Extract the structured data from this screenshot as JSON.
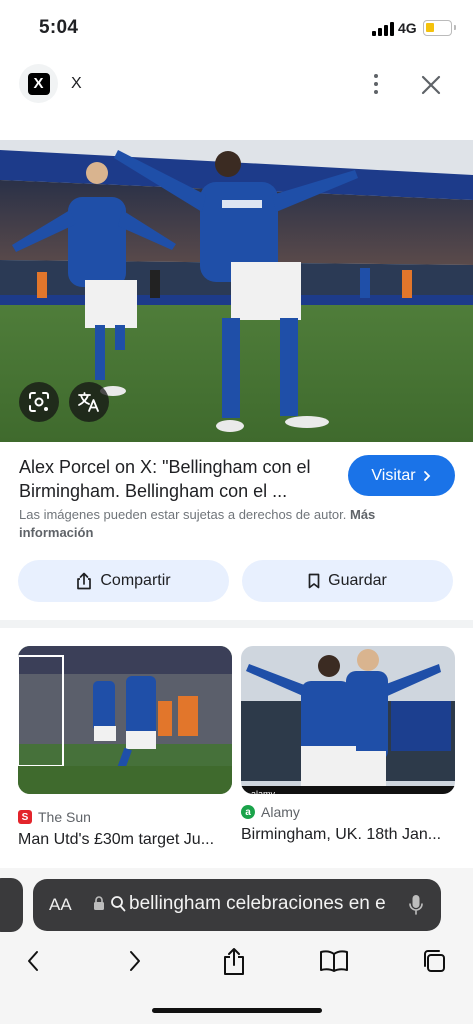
{
  "status_bar": {
    "time": "5:04",
    "network": "4G",
    "battery_level": 0.35
  },
  "header": {
    "site_name": "X",
    "logo_letter": "X"
  },
  "result": {
    "title_line1": "Alex Porcel on X: \"Bellingham con el",
    "title_line2": "Birmingham. Bellingham con el ...",
    "visit_label": "Visitar",
    "copyright_text": "Las imágenes pueden estar sujetas a derechos de autor. ",
    "copyright_link_line1": "Más",
    "copyright_link_line2": "información"
  },
  "actions": {
    "share_label": "Compartir",
    "save_label": "Guardar"
  },
  "related": [
    {
      "source": "The Sun",
      "title": "Man Utd's £30m target Ju...",
      "favicon_letter": "S",
      "favicon_color": "#e3242b"
    },
    {
      "source": "Alamy",
      "title": "Birmingham, UK. 18th Jan...",
      "favicon_letter": "a",
      "favicon_color": "#1aa34a",
      "watermark": "alamy"
    }
  ],
  "browser": {
    "text_size_label": "AA",
    "query": "bellingham celebraciones en e"
  },
  "colors": {
    "accent": "#1a73e8",
    "pill_bg": "#e8f0fe",
    "kit_blue": "#1f4fa8"
  }
}
